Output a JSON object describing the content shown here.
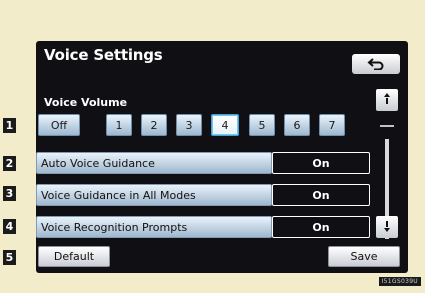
{
  "header": {
    "title": "Voice Settings",
    "back_icon": "back-arrow-icon"
  },
  "volume": {
    "label": "Voice Volume",
    "options": [
      "Off",
      "1",
      "2",
      "3",
      "4",
      "5",
      "6",
      "7"
    ],
    "selected": "4"
  },
  "settings": [
    {
      "label": "Auto Voice Guidance",
      "value": "On"
    },
    {
      "label": "Voice Guidance in All Modes",
      "value": "On"
    },
    {
      "label": "Voice Recognition Prompts",
      "value": "On"
    }
  ],
  "footer": {
    "default_label": "Default",
    "save_label": "Save"
  },
  "callouts": [
    "1",
    "2",
    "3",
    "4",
    "5"
  ],
  "image_code": "I51GS039U"
}
